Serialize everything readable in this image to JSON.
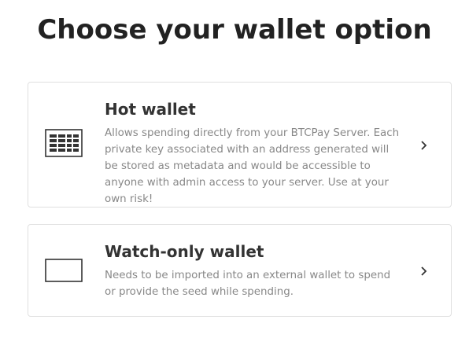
{
  "title": "Choose your wallet option",
  "options": [
    {
      "title": "Hot wallet",
      "description": "Allows spending directly from your BTCPay Server. Each private key associated with an address generated will be stored as metadata and would be accessible to anyone with admin access to your server. Use at your own risk!",
      "icon": "hot-wallet-grid-icon"
    },
    {
      "title": "Watch-only wallet",
      "description": "Needs to be imported into an external wallet to spend or provide the seed while spending.",
      "icon": "watch-only-wallet-icon"
    }
  ],
  "colors": {
    "text_dark": "#222222",
    "text_muted": "#888888",
    "border": "#e0e0e0",
    "icon_stroke": "#333333"
  }
}
